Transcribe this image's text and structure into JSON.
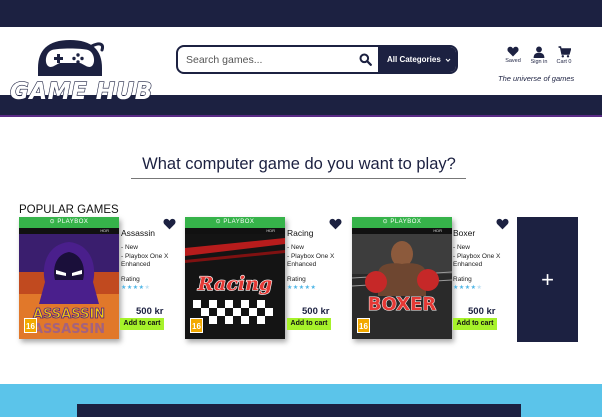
{
  "brand": {
    "logo_text": "GAME HUB",
    "tagline": "The universe of games"
  },
  "search": {
    "placeholder": "Search games...",
    "category_label": "All Categories"
  },
  "header_icons": [
    {
      "label": "Saved",
      "icon": "heart-icon"
    },
    {
      "label": "Sign in",
      "icon": "user-icon"
    },
    {
      "label": "Cart 0",
      "icon": "cart-icon"
    }
  ],
  "main": {
    "question": "What computer game do you want to play?",
    "section_title": "POPULAR GAMES"
  },
  "games": [
    {
      "title": "Assassin",
      "cover_text": "ASSASSIN",
      "platform": "PLAYBOX",
      "hdr": "HDR",
      "age": "16",
      "details": [
        "- New",
        "- Playbox One X",
        "Enhanced"
      ],
      "rating_label": "Rating",
      "rating": 4,
      "rating_max": 5,
      "price": "500 kr",
      "cart_label": "Add to cart"
    },
    {
      "title": "Racing",
      "cover_text": "Racing",
      "platform": "PLAYBOX",
      "hdr": "HDR",
      "age": "16",
      "details": [
        "- New",
        "- Playbox One X",
        "Enhanced"
      ],
      "rating_label": "Rating",
      "rating": 5,
      "rating_max": 5,
      "price": "500 kr",
      "cart_label": "Add to cart"
    },
    {
      "title": "Boxer",
      "cover_text": "BOXER",
      "platform": "PLAYBOX",
      "hdr": "HDR",
      "age": "16",
      "details": [
        "- New",
        "- Playbox One X",
        "Enhanced"
      ],
      "rating_label": "Rating",
      "rating": 4,
      "rating_max": 5,
      "price": "500 kr",
      "cart_label": "Add to cart"
    }
  ],
  "add_card": {
    "label": "+"
  },
  "colors": {
    "navy": "#1c2141",
    "accent_green": "#a6f22a",
    "star_blue": "#4fb6e6",
    "band_blue": "#5bc4ea"
  }
}
